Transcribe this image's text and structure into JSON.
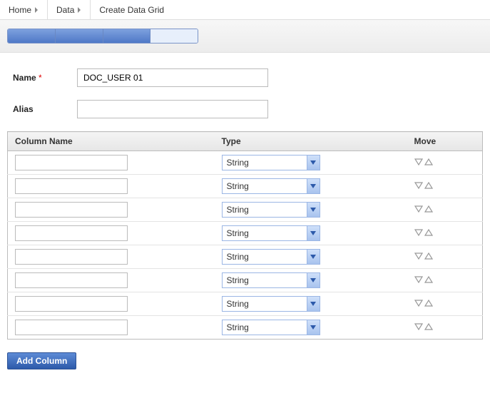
{
  "breadcrumb": {
    "home": "Home",
    "data": "Data",
    "current": "Create Data Grid"
  },
  "progress": {
    "total_segments": 4,
    "filled_segments": 3
  },
  "form": {
    "name_label": "Name",
    "name_value": "DOC_USER 01",
    "alias_label": "Alias",
    "alias_value": ""
  },
  "table": {
    "headers": {
      "col_name": "Column Name",
      "type": "Type",
      "move": "Move"
    },
    "rows": [
      {
        "name": "",
        "type": "String"
      },
      {
        "name": "",
        "type": "String"
      },
      {
        "name": "",
        "type": "String"
      },
      {
        "name": "",
        "type": "String"
      },
      {
        "name": "",
        "type": "String"
      },
      {
        "name": "",
        "type": "String"
      },
      {
        "name": "",
        "type": "String"
      },
      {
        "name": "",
        "type": "String"
      }
    ]
  },
  "buttons": {
    "add_column": "Add Column"
  },
  "colors": {
    "accent": "#4f79c7"
  }
}
